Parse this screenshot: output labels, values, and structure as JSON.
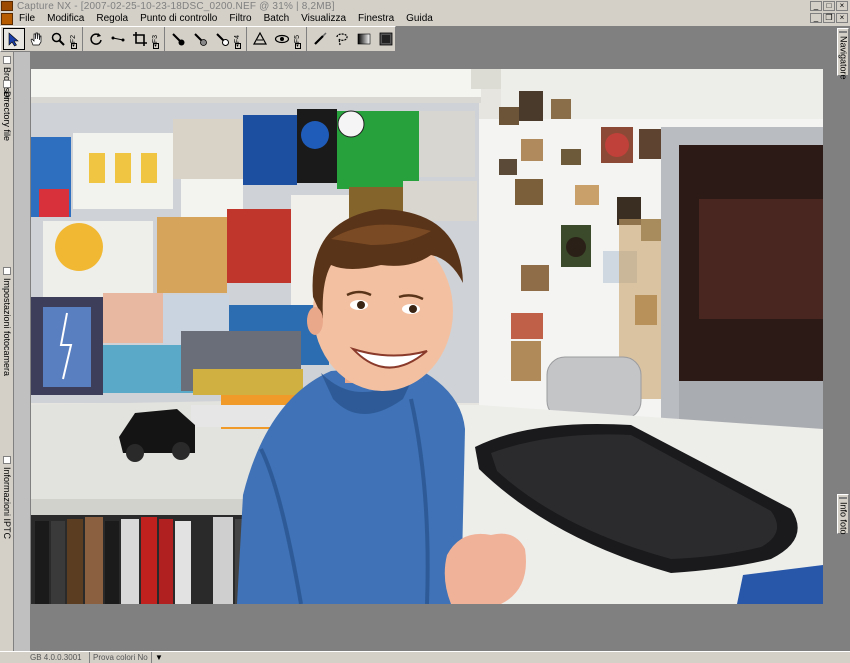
{
  "titlebar": {
    "title": "Capture  NX  -  [2007-02-25-10-23-18DSC_0200.NEF @ 31%  |  8,2MB]",
    "min": "_",
    "max": "□",
    "close": "×"
  },
  "menubar": {
    "items": [
      "File",
      "Modifica",
      "Regola",
      "Punto di controllo",
      "Filtro",
      "Batch",
      "Visualizza",
      "Finestra",
      "Guida"
    ],
    "min": "_",
    "restore": "❐",
    "close": "×"
  },
  "toolbar": {
    "fkeys": [
      "F2",
      "F3",
      "F4",
      "F5",
      "F6"
    ]
  },
  "left_dock": {
    "tabs": [
      "Browser",
      "Directory file",
      "Impostazioni fotocamera",
      "Informazioni IPTC"
    ]
  },
  "right_dock": {
    "tabs": [
      "Navigatore",
      "Info foto"
    ]
  },
  "statusbar": {
    "memory": "GB 4.0.0.3001",
    "softproof": "Prova colori No",
    "arrow": "▼"
  },
  "colors": {
    "chrome": "#d4d0c8",
    "canvas": "#808080",
    "sweater": "#3f72b6"
  }
}
